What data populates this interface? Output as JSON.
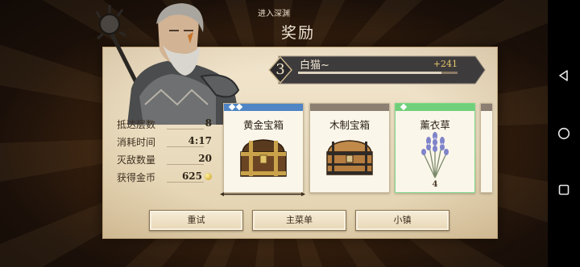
{
  "header": {
    "subtitle": "进入深渊",
    "title": "奖励"
  },
  "player": {
    "level": "3",
    "name": "白猫~",
    "xp_gain": "+241",
    "xp_progress": 0.9
  },
  "stats": [
    {
      "label": "抵达层数",
      "value": "8"
    },
    {
      "label": "消耗时间",
      "value": "4:17"
    },
    {
      "label": "灭敌数量",
      "value": "20"
    },
    {
      "label": "获得金币",
      "value": "625",
      "icon": "coin-icon"
    }
  ],
  "rewards": [
    {
      "name": "黄金宝箱",
      "rarity_color": "#4f85c4",
      "diamonds": 2,
      "count": "",
      "icon": "golden-chest-icon"
    },
    {
      "name": "木制宝箱",
      "rarity_color": "#8c7f72",
      "diamonds": 0,
      "count": "",
      "icon": "wooden-chest-icon"
    },
    {
      "name": "薰衣草",
      "rarity_color": "#6fcf7a",
      "diamonds": 1,
      "count": "4",
      "icon": "lavender-icon"
    }
  ],
  "buttons": {
    "retry": "重试",
    "main_menu": "主菜单",
    "town": "小镇"
  },
  "colors": {
    "accent_gold": "#e6c86a",
    "parchment": "#ecdfc4",
    "dark_banner": "#3e3b3c"
  }
}
